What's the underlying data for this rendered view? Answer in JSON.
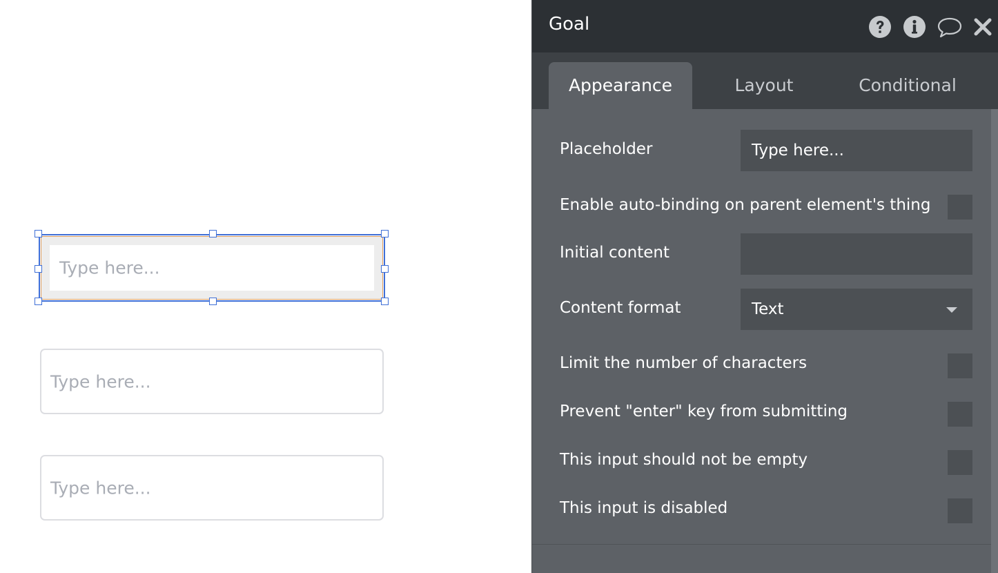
{
  "canvas": {
    "selected_input": {
      "placeholder": "Type here..."
    },
    "inputs": [
      {
        "placeholder": "Type here..."
      },
      {
        "placeholder": "Type here..."
      }
    ]
  },
  "panel": {
    "title": "Goal",
    "header_icons": [
      "help-icon",
      "info-icon",
      "comment-icon",
      "close-icon"
    ],
    "tabs": [
      {
        "label": "Appearance",
        "active": true
      },
      {
        "label": "Layout",
        "active": false
      },
      {
        "label": "Conditional",
        "active": false
      }
    ],
    "placeholder": {
      "label": "Placeholder",
      "value": "Type here..."
    },
    "auto_binding": {
      "label": "Enable auto-binding on parent element's thing",
      "checked": false
    },
    "initial_content": {
      "label": "Initial content",
      "value": ""
    },
    "content_format": {
      "label": "Content format",
      "value": "Text"
    },
    "limit_chars": {
      "label": "Limit the number of characters",
      "checked": false
    },
    "prevent_enter": {
      "label": "Prevent \"enter\" key from submitting",
      "checked": false
    },
    "not_empty": {
      "label": "This input should not be empty",
      "checked": false
    },
    "disabled": {
      "label": "This input is disabled",
      "checked": false
    }
  },
  "colors": {
    "selection": "#3f6fd6",
    "panel_bg": "#5d6166",
    "header_bg": "#2c3034",
    "field_bg": "#4c5054"
  }
}
